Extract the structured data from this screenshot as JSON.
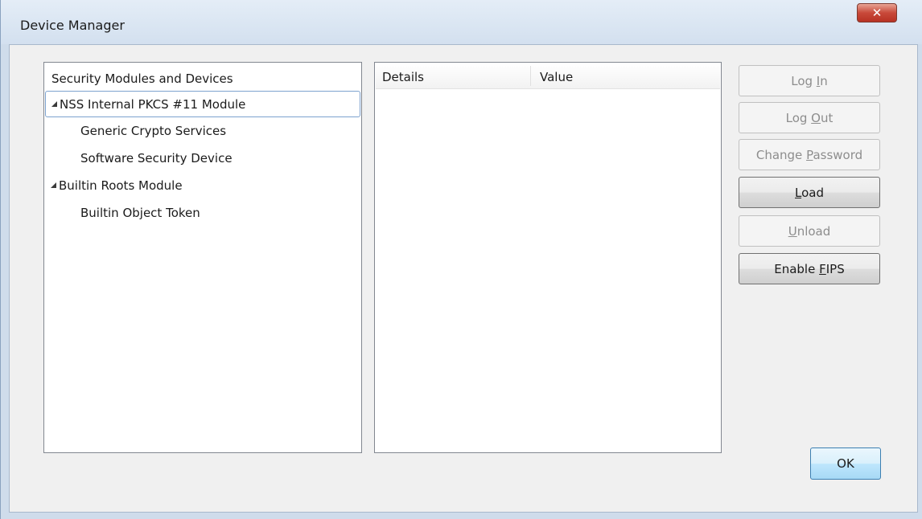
{
  "window": {
    "title": "Device Manager",
    "close_glyph": "✕"
  },
  "tree": {
    "header": "Security Modules and Devices",
    "rows": [
      {
        "label": "NSS Internal PKCS #11 Module",
        "level": 0,
        "expanded": true,
        "selected": true
      },
      {
        "label": "Generic Crypto Services",
        "level": 1
      },
      {
        "label": "Software Security Device",
        "level": 1
      },
      {
        "label": "Builtin Roots Module",
        "level": 0,
        "expanded": true
      },
      {
        "label": "Builtin Object Token",
        "level": 1
      }
    ]
  },
  "details": {
    "col_details": "Details",
    "col_value": "Value"
  },
  "buttons": {
    "log_in": {
      "before": "Log ",
      "mnemonic": "I",
      "after": "n",
      "enabled": false
    },
    "log_out": {
      "before": "Log ",
      "mnemonic": "O",
      "after": "ut",
      "enabled": false
    },
    "change_password": {
      "before": "Change ",
      "mnemonic": "P",
      "after": "assword",
      "enabled": false
    },
    "load": {
      "before": "",
      "mnemonic": "L",
      "after": "oad",
      "enabled": true
    },
    "unload": {
      "before": "",
      "mnemonic": "U",
      "after": "nload",
      "enabled": false
    },
    "enable_fips": {
      "before": "Enable ",
      "mnemonic": "F",
      "after": "IPS",
      "enabled": true
    }
  },
  "ok_label": "OK",
  "colors": {
    "frame": "#cfdceb",
    "close_button": "#c8493a",
    "selection_border": "#7da2ce",
    "disabled_text": "#8d8d8d"
  }
}
